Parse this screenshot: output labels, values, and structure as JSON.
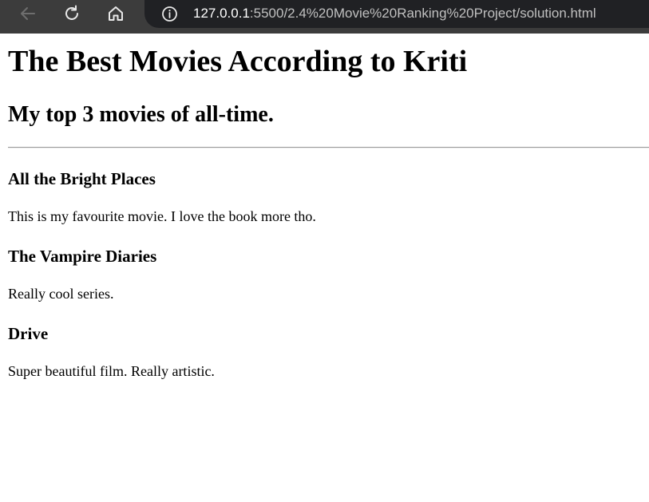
{
  "browser": {
    "url_host": "127.0.0.1",
    "url_path": ":5500/2.4%20Movie%20Ranking%20Project/solution.html"
  },
  "page": {
    "title": "The Best Movies According to Kriti",
    "subtitle": "My top 3 movies of all-time.",
    "movies": [
      {
        "title": "All the Bright Places",
        "description": "This is my favourite movie. I love the book more tho."
      },
      {
        "title": "The Vampire Diaries",
        "description": "Really cool series."
      },
      {
        "title": "Drive",
        "description": "Super beautiful film. Really artistic."
      }
    ]
  }
}
